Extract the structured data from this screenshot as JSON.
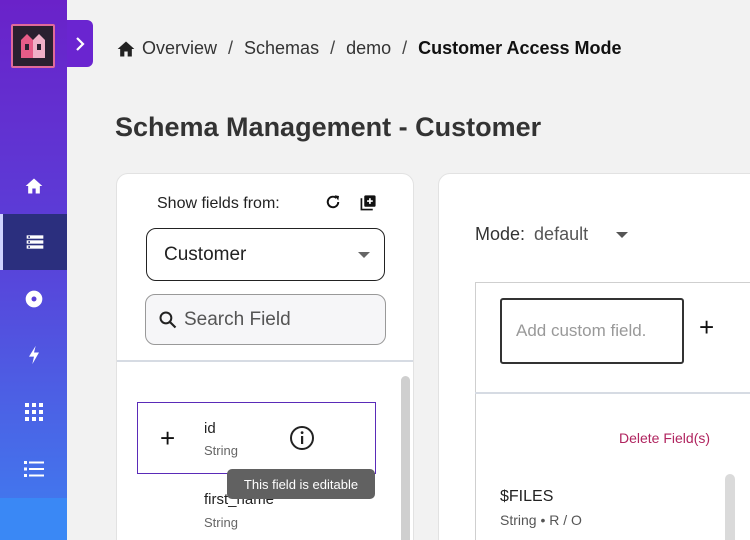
{
  "breadcrumb": {
    "items": [
      "Overview",
      "Schemas",
      "demo"
    ],
    "separator": "/",
    "current": "Customer Access Mode"
  },
  "page_title": "Schema Management - Customer",
  "left_panel": {
    "show_fields_label": "Show fields from:",
    "selected_source": "Customer",
    "search_placeholder": "Search Field",
    "fields": [
      {
        "name": "id",
        "type": "String"
      },
      {
        "name": "first_name",
        "type": "String"
      }
    ],
    "tooltip": "This field is editable"
  },
  "right_panel": {
    "mode_label": "Mode:",
    "mode_value": "default",
    "custom_field_placeholder": "Add custom field.",
    "delete_label": "Delete Field(s)",
    "file_field": {
      "name": "$FILES",
      "type": "String • R / O"
    }
  },
  "colors": {
    "sidebar_top": "#6a22c9",
    "sidebar_bottom": "#3f7ef0",
    "active_nav": "#2b2f7e",
    "field_border": "#5a2bb8",
    "delete_link": "#b0245f",
    "tooltip_bg": "#616161"
  },
  "icons": {
    "sidebar": [
      "home-icon",
      "list-icon",
      "disc-icon",
      "bolt-icon",
      "grid-icon",
      "list-bullets-icon"
    ],
    "expand": "chevron-right-icon",
    "refresh": "refresh-icon",
    "add_box": "add-box-icon",
    "search": "search-icon",
    "info": "info-icon",
    "plus": "plus-icon"
  }
}
